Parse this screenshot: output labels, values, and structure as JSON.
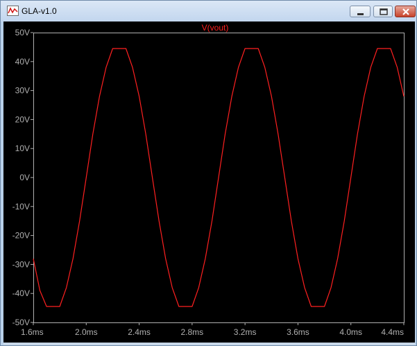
{
  "window": {
    "title": "GLA-v1.0",
    "icons": {
      "app": "waveform-icon",
      "minimize": "minimize-icon",
      "maximize": "maximize-icon",
      "close": "close-icon"
    }
  },
  "colors": {
    "background": "#000000",
    "trace": "#ff2020",
    "axis": "#b0b0b0",
    "title_bar": "#c6d8ee"
  },
  "chart_data": {
    "type": "line",
    "title": "V(vout)",
    "xlabel": "",
    "ylabel": "",
    "xlim": [
      1.6,
      4.4
    ],
    "ylim": [
      -50,
      50
    ],
    "grid": false,
    "x_ticks": [
      1.6,
      2.0,
      2.4,
      2.8,
      3.2,
      3.6,
      4.0,
      4.4
    ],
    "x_tick_labels": [
      "1.6ms",
      "2.0ms",
      "2.4ms",
      "2.8ms",
      "3.2ms",
      "3.6ms",
      "4.0ms",
      "4.4ms"
    ],
    "y_ticks": [
      50,
      40,
      30,
      20,
      10,
      0,
      -10,
      -20,
      -30,
      -40,
      -50
    ],
    "y_tick_labels": [
      "50V",
      "40V",
      "30V",
      "20V",
      "10V",
      "0V",
      "-10V",
      "-20V",
      "-30V",
      "-40V",
      "-50V"
    ],
    "series": [
      {
        "name": "V(vout)",
        "x": [
          1.6,
          1.65,
          1.7,
          1.74,
          1.8,
          1.85,
          1.9,
          1.95,
          2.0,
          2.05,
          2.1,
          2.15,
          2.2,
          2.23,
          2.3,
          2.35,
          2.4,
          2.45,
          2.5,
          2.55,
          2.6,
          2.65,
          2.7,
          2.73,
          2.8,
          2.85,
          2.9,
          2.95,
          3.0,
          3.05,
          3.1,
          3.15,
          3.2,
          3.23,
          3.3,
          3.35,
          3.4,
          3.45,
          3.5,
          3.55,
          3.6,
          3.65,
          3.7,
          3.73,
          3.8,
          3.85,
          3.9,
          3.95,
          4.0,
          4.05,
          4.1,
          4.15,
          4.2,
          4.23,
          4.3,
          4.35,
          4.4
        ],
        "y": [
          -28,
          -39,
          -44.5,
          -44.5,
          -44.5,
          -38,
          -28,
          -15,
          0,
          15,
          28,
          38,
          44.5,
          44.5,
          44.5,
          38,
          28,
          15,
          0,
          -15,
          -28,
          -38,
          -44.5,
          -44.5,
          -44.5,
          -38,
          -28,
          -15,
          0,
          15,
          28,
          38,
          44.5,
          44.5,
          44.5,
          38,
          28,
          15,
          0,
          -15,
          -28,
          -38,
          -44.5,
          -44.5,
          -44.5,
          -38,
          -28,
          -15,
          0,
          15,
          28,
          38,
          44.5,
          44.5,
          44.5,
          38,
          28
        ]
      }
    ]
  }
}
